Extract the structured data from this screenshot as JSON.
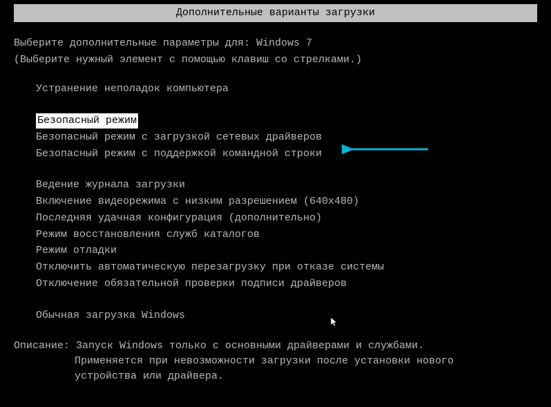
{
  "title": "Дополнительные варианты загрузки",
  "intro_prefix": "Выберите дополнительные параметры для: ",
  "os_name": "Windows 7",
  "instruction_sub": "(Выберите нужный элемент с помощью клавиш со стрелками.)",
  "menu": {
    "group1": [
      "Устранение неполадок компьютера"
    ],
    "group2": [
      "Безопасный режим",
      "Безопасный режим с загрузкой сетевых драйверов",
      "Безопасный режим с поддержкой командной строки"
    ],
    "group3": [
      "Ведение журнала загрузки",
      "Включение видеорежима с низким разрешением (640x480)",
      "Последняя удачная конфигурация (дополнительно)",
      "Режим восстановления служб каталогов",
      "Режим отладки",
      "Отключить автоматическую перезагрузку при отказе системы",
      "Отключение обязательной проверки подписи драйверов"
    ],
    "group4": [
      "Обычная загрузка Windows"
    ]
  },
  "description_label": "Описание: ",
  "description_line1": "Запуск Windows только с основными драйверами и службами.",
  "description_line2": "Применяется при невозможности загрузки после установки нового",
  "description_line3": "устройства или драйвера."
}
